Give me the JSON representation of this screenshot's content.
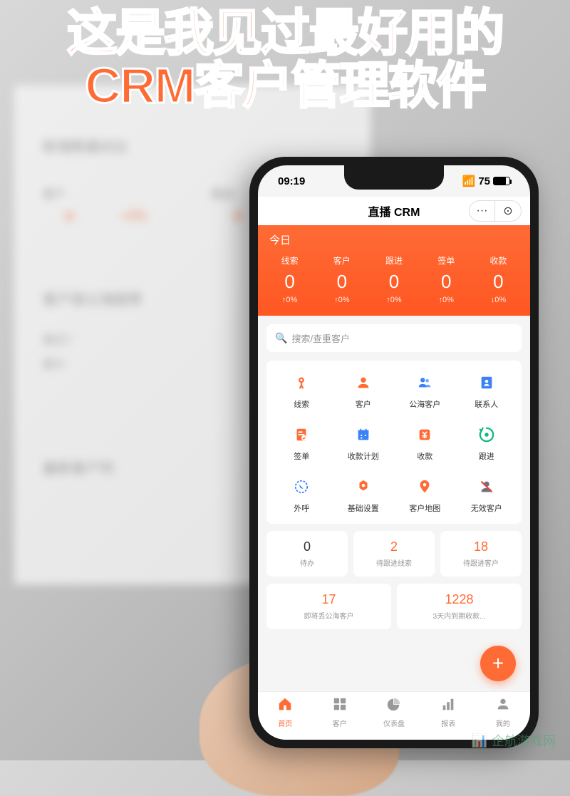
{
  "headline": {
    "line1": "这是我见过最好用的",
    "line2": "CRM客户管理软件"
  },
  "bg": {
    "title1": "新增数据对比",
    "col1": "客户",
    "col2": "跟进",
    "pct": "+0%",
    "title2": "客户放公海趋势",
    "row1": "最近7",
    "row2": "最大",
    "title3": "最新客户列"
  },
  "status": {
    "time": "09:19",
    "battery": "75"
  },
  "header": {
    "title": "直播 CRM",
    "more": "···",
    "close": "⊙"
  },
  "today": {
    "label": "今日",
    "stats": [
      {
        "label": "线索",
        "value": "0",
        "change": "↑0%"
      },
      {
        "label": "客户",
        "value": "0",
        "change": "↑0%"
      },
      {
        "label": "跟进",
        "value": "0",
        "change": "↑0%"
      },
      {
        "label": "签单",
        "value": "0",
        "change": "↑0%"
      },
      {
        "label": "收款",
        "value": "0",
        "change": "↓0%"
      }
    ]
  },
  "search": {
    "placeholder": "搜索/查重客户"
  },
  "grid": [
    {
      "label": "线索",
      "color": "#ff6b35",
      "icon": "leads"
    },
    {
      "label": "客户",
      "color": "#ff6b35",
      "icon": "customer"
    },
    {
      "label": "公海客户",
      "color": "#3b82f6",
      "icon": "pool"
    },
    {
      "label": "联系人",
      "color": "#3b82f6",
      "icon": "contact"
    },
    {
      "label": "签单",
      "color": "#ff6b35",
      "icon": "order"
    },
    {
      "label": "收款计划",
      "color": "#3b82f6",
      "icon": "plan"
    },
    {
      "label": "收款",
      "color": "#ff6b35",
      "icon": "payment"
    },
    {
      "label": "跟进",
      "color": "#10b981",
      "icon": "followup"
    },
    {
      "label": "外呼",
      "color": "#3b82f6",
      "icon": "call"
    },
    {
      "label": "基础设置",
      "color": "#ff6b35",
      "icon": "settings"
    },
    {
      "label": "客户地图",
      "color": "#ff6b35",
      "icon": "map"
    },
    {
      "label": "无效客户",
      "color": "#6b7280",
      "icon": "invalid"
    }
  ],
  "todos": [
    {
      "value": "0",
      "label": "待办",
      "cls": "c-black"
    },
    {
      "value": "2",
      "label": "待跟进线索",
      "cls": "c-orange"
    },
    {
      "value": "18",
      "label": "待跟进客户",
      "cls": "c-orange"
    }
  ],
  "todos2": [
    {
      "value": "17",
      "label": "即将丢公海客户",
      "cls": "c-orange"
    },
    {
      "value": "1228",
      "label": "3天内到期收款...",
      "cls": "c-orange"
    }
  ],
  "nav": [
    {
      "label": "首页",
      "icon": "home",
      "active": true
    },
    {
      "label": "客户",
      "icon": "grid",
      "active": false
    },
    {
      "label": "仪表盘",
      "icon": "dashboard",
      "active": false
    },
    {
      "label": "报表",
      "icon": "report",
      "active": false
    },
    {
      "label": "我的",
      "icon": "user",
      "active": false
    }
  ],
  "watermark": "企航游戏网"
}
